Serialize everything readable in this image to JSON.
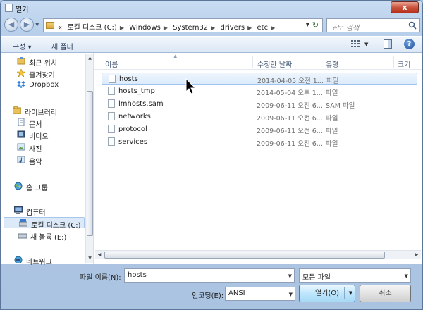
{
  "window": {
    "title": "열기",
    "close_label": "x"
  },
  "address": {
    "breadcrumbs": [
      "«",
      "로컬 디스크 (C:)",
      "Windows",
      "System32",
      "drivers",
      "etc"
    ],
    "search_placeholder": "etc 검색"
  },
  "toolbar": {
    "organize": "구성 ▾",
    "new_folder": "새 폴더"
  },
  "sidebar": {
    "items": [
      {
        "label": "최근 위치"
      },
      {
        "label": "즐겨찾기"
      },
      {
        "label": "Dropbox"
      },
      {
        "label": "라이브러리"
      },
      {
        "label": "문서"
      },
      {
        "label": "비디오"
      },
      {
        "label": "사진"
      },
      {
        "label": "음악"
      },
      {
        "label": "홈 그룹"
      },
      {
        "label": "컴퓨터"
      },
      {
        "label": "로컬 디스크 (C:)"
      },
      {
        "label": "새 볼륨 (E:)"
      },
      {
        "label": "네트워크"
      }
    ]
  },
  "columns": {
    "name": "이름",
    "modified": "수정한 날짜",
    "type": "유형",
    "size": "크기"
  },
  "files": [
    {
      "name": "hosts",
      "modified": "2014-04-05 오전 1...",
      "type": "파일"
    },
    {
      "name": "hosts_tmp",
      "modified": "2014-05-04 오후 1...",
      "type": "파일"
    },
    {
      "name": "lmhosts.sam",
      "modified": "2009-06-11 오전 6...",
      "type": "SAM 파일"
    },
    {
      "name": "networks",
      "modified": "2009-06-11 오전 6...",
      "type": "파일"
    },
    {
      "name": "protocol",
      "modified": "2009-06-11 오전 6...",
      "type": "파일"
    },
    {
      "name": "services",
      "modified": "2009-06-11 오전 6...",
      "type": "파일"
    }
  ],
  "bottom": {
    "filename_label": "파일 이름(N):",
    "filename_value": "hosts",
    "filter_value": "모든 파일",
    "encoding_label": "인코딩(E):",
    "encoding_value": "ANSI",
    "open_label": "열기(O)",
    "cancel_label": "취소"
  }
}
